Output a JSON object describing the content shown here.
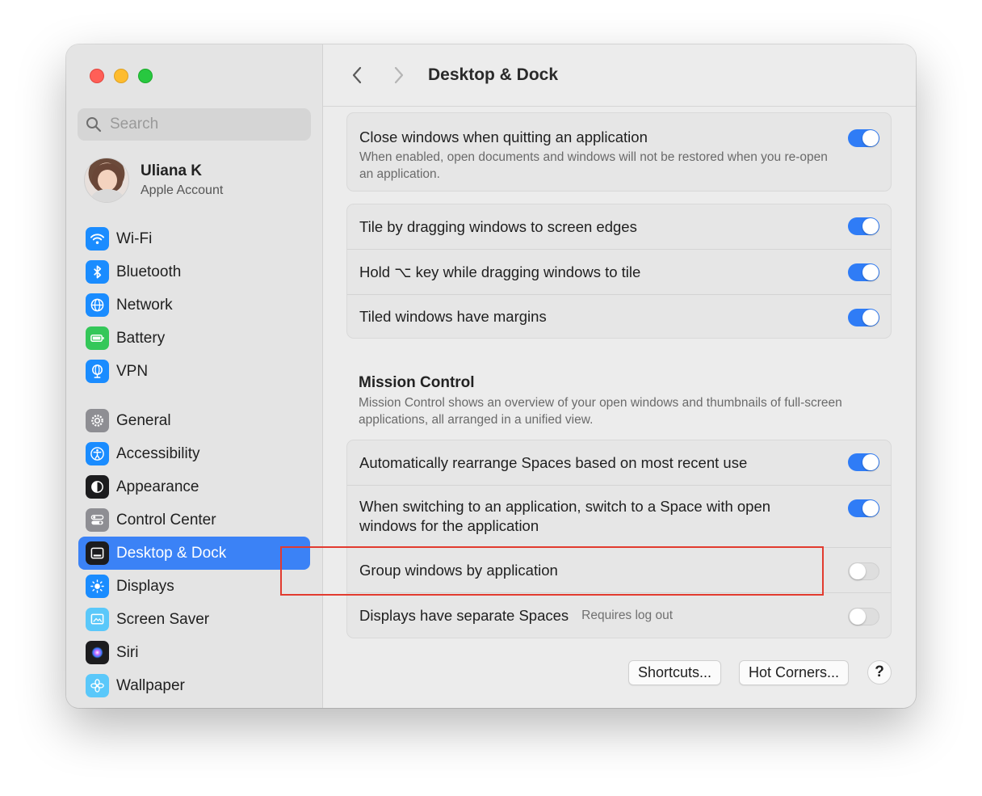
{
  "window": {
    "title": "Desktop & Dock"
  },
  "search": {
    "placeholder": "Search"
  },
  "account": {
    "name": "Uliana K",
    "subtitle": "Apple Account"
  },
  "sidebar": {
    "group1": [
      {
        "label": "Wi-Fi",
        "icon": "wifi-icon",
        "color": "#1a8cff"
      },
      {
        "label": "Bluetooth",
        "icon": "bluetooth-icon",
        "color": "#1a8cff"
      },
      {
        "label": "Network",
        "icon": "globe-icon",
        "color": "#1a8cff"
      },
      {
        "label": "Battery",
        "icon": "battery-icon",
        "color": "#34c759"
      },
      {
        "label": "VPN",
        "icon": "vpn-globe-icon",
        "color": "#1a8cff"
      }
    ],
    "group2": [
      {
        "label": "General",
        "icon": "gear-icon",
        "color": "#8e8e93"
      },
      {
        "label": "Accessibility",
        "icon": "accessibility-icon",
        "color": "#1a8cff"
      },
      {
        "label": "Appearance",
        "icon": "appearance-icon",
        "color": "#1c1c1e"
      },
      {
        "label": "Control Center",
        "icon": "control-center-icon",
        "color": "#8e8e93"
      },
      {
        "label": "Desktop & Dock",
        "icon": "dock-icon",
        "color": "#1c1c1e",
        "active": true
      },
      {
        "label": "Displays",
        "icon": "sun-icon",
        "color": "#1a8cff"
      },
      {
        "label": "Screen Saver",
        "icon": "screen-saver-icon",
        "color": "#5ac8fa"
      },
      {
        "label": "Siri",
        "icon": "siri-icon",
        "color": "#1c1c1e"
      },
      {
        "label": "Wallpaper",
        "icon": "flower-icon",
        "color": "#5ac8fa"
      }
    ]
  },
  "settings": {
    "close_windows": {
      "label": "Close windows when quitting an application",
      "description": "When enabled, open documents and windows will not be restored when you re-open an application.",
      "enabled": true
    },
    "tiling": [
      {
        "label": "Tile by dragging windows to screen edges",
        "enabled": true
      },
      {
        "label": "Hold ⌥ key while dragging windows to tile",
        "enabled": true
      },
      {
        "label": "Tiled windows have margins",
        "enabled": true
      }
    ],
    "mission_control": {
      "title": "Mission Control",
      "description": "Mission Control shows an overview of your open windows and thumbnails of full-screen applications, all arranged in a unified view.",
      "rows": [
        {
          "label": "Automatically rearrange Spaces based on most recent use",
          "enabled": true
        },
        {
          "label": "When switching to an application, switch to a Space with open windows for the application",
          "enabled": true
        },
        {
          "label": "Group windows by application",
          "enabled": false
        },
        {
          "label": "Displays have separate Spaces",
          "hint": "Requires log out",
          "enabled": false
        }
      ]
    }
  },
  "buttons": {
    "shortcuts": "Shortcuts...",
    "hot_corners": "Hot Corners...",
    "help": "?"
  },
  "colors": {
    "accent": "#2f7cf6",
    "highlight_border": "#e23b2f"
  }
}
